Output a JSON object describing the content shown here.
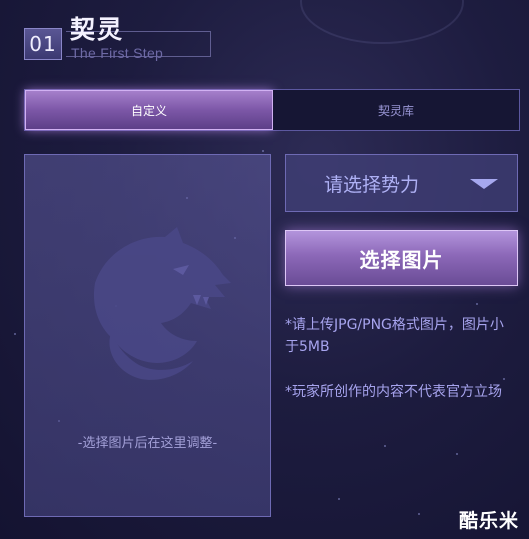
{
  "header": {
    "step_number": "01",
    "title": "契灵",
    "subtitle": "The First Step"
  },
  "tabs": [
    {
      "label": "自定义",
      "active": true
    },
    {
      "label": "契灵库",
      "active": false
    }
  ],
  "image_panel": {
    "hint": "-选择图片后在这里调整-"
  },
  "faction_select": {
    "selected": "请选择势力"
  },
  "choose_image_button": {
    "label": "选择图片"
  },
  "notes": [
    "*请上传JPG/PNG格式图片，图片小于5MB",
    "*玩家所创作的内容不代表官方立场"
  ],
  "watermark": "酷乐米",
  "colors": {
    "background": "#1d1c3f",
    "accent_purple": "#8c68b8",
    "text_light": "#a7a4ee",
    "panel_border": "#6e6ab4"
  }
}
